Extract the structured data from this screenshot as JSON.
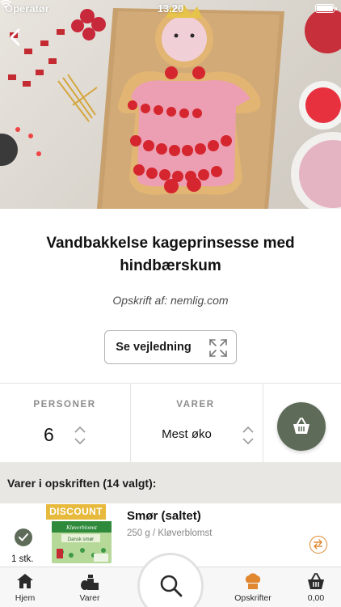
{
  "status_bar": {
    "carrier": "Operatør",
    "time": "13.20"
  },
  "recipe": {
    "title_line1": "Vandbakkelse kageprinsesse med",
    "title_line2": "hindbærskum",
    "author": "Opskrift af: nemlig.com",
    "guide_button": "Se vejledning"
  },
  "selectors": {
    "persons_label": "PERSONER",
    "persons_value": "6",
    "varer_label": "VARER",
    "varer_value": "Mest øko"
  },
  "ingredients": {
    "header": "Varer i opskriften (14 valgt):",
    "items": [
      {
        "badge": "DISCOUNT",
        "name": "Smør (saltet)",
        "detail": "250 g / Kløverblomst",
        "quantity": "1 stk.",
        "package_brand": "Kløverblomst",
        "package_text": "Dansk smør"
      }
    ]
  },
  "tab_bar": {
    "items": [
      {
        "label": "Hjem",
        "icon": "home-icon"
      },
      {
        "label": "Varer",
        "icon": "groceries-icon"
      },
      {
        "label": "Opskrifter",
        "icon": "chef-hat-icon"
      },
      {
        "label": "0,00",
        "icon": "basket-icon"
      }
    ],
    "search_icon": "search-icon"
  },
  "colors": {
    "accent_green": "#5e6b58",
    "accent_orange": "#e0872f",
    "discount_yellow": "#e7b93c"
  }
}
